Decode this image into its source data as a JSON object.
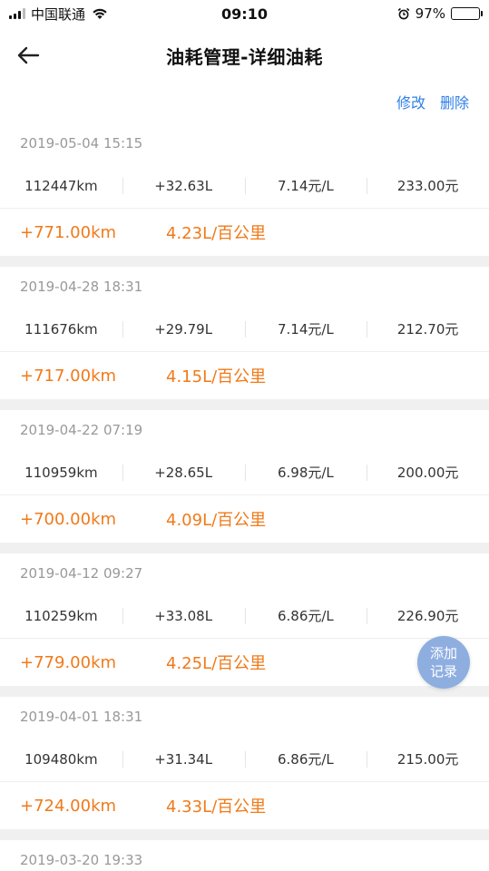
{
  "status_bar": {
    "carrier": "中国联通",
    "time": "09:10",
    "battery_percent": "97%",
    "battery_level": 0.97
  },
  "nav": {
    "title": "油耗管理-详细油耗"
  },
  "actions": {
    "edit_label": "修改",
    "delete_label": "删除"
  },
  "records": [
    {
      "date": "2019-05-04 15:15",
      "odometer": "112447km",
      "fuel_added": "+32.63L",
      "price_per_liter": "7.14元/L",
      "cost": "233.00元",
      "distance": "+771.00km",
      "consumption": "4.23L/百公里"
    },
    {
      "date": "2019-04-28 18:31",
      "odometer": "111676km",
      "fuel_added": "+29.79L",
      "price_per_liter": "7.14元/L",
      "cost": "212.70元",
      "distance": "+717.00km",
      "consumption": "4.15L/百公里"
    },
    {
      "date": "2019-04-22 07:19",
      "odometer": "110959km",
      "fuel_added": "+28.65L",
      "price_per_liter": "6.98元/L",
      "cost": "200.00元",
      "distance": "+700.00km",
      "consumption": "4.09L/百公里"
    },
    {
      "date": "2019-04-12 09:27",
      "odometer": "110259km",
      "fuel_added": "+33.08L",
      "price_per_liter": "6.86元/L",
      "cost": "226.90元",
      "distance": "+779.00km",
      "consumption": "4.25L/百公里"
    },
    {
      "date": "2019-04-01 18:31",
      "odometer": "109480km",
      "fuel_added": "+31.34L",
      "price_per_liter": "6.86元/L",
      "cost": "215.00元",
      "distance": "+724.00km",
      "consumption": "4.33L/百公里"
    }
  ],
  "partial_record": {
    "date": "2019-03-20 19:33"
  },
  "fab": {
    "line1": "添加",
    "line2": "记录"
  },
  "colors": {
    "accent_blue": "#2f7fe6",
    "orange": "#f07a19",
    "fab_bg": "#8eaee0"
  }
}
